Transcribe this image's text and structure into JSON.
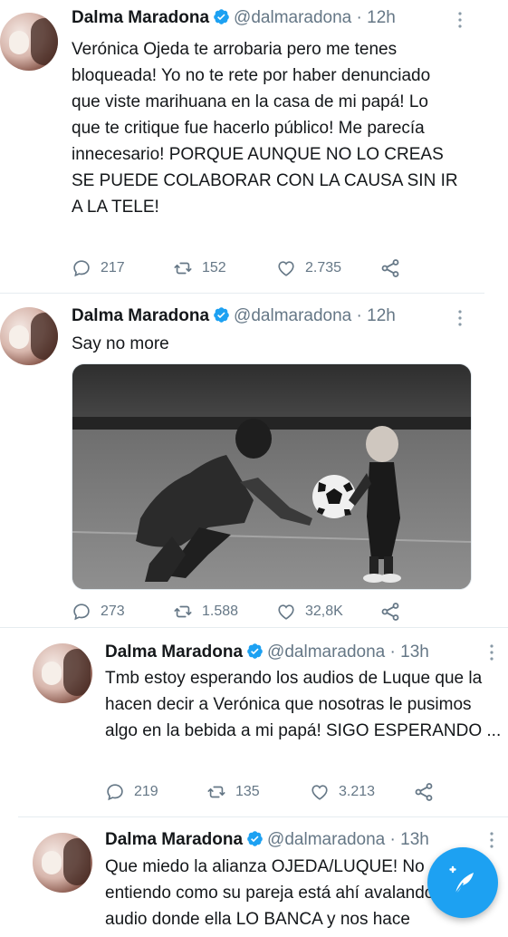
{
  "colors": {
    "accent": "#1da1f2",
    "text": "#14171a",
    "secondary": "#657786",
    "divider": "#e6ecf0"
  },
  "tweets": [
    {
      "author_name": "Dalma Maradona",
      "handle": "@dalmaradona",
      "separator": "·",
      "time": "12h",
      "verified": true,
      "text": "Verónica Ojeda te arrobaria pero me tenes bloqueada! Yo no te rete por haber denunciado que viste marihuana en la casa de mi papá! Lo que te critique fue hacerlo público! Me parecía innecesario! PORQUE AUNQUE NO LO CREAS SE PUEDE COLABORAR CON LA CAUSA SIN IR A LA TELE!",
      "replies": "217",
      "retweets": "152",
      "likes": "2.735"
    },
    {
      "author_name": "Dalma Maradona",
      "handle": "@dalmaradona",
      "separator": "·",
      "time": "12h",
      "verified": true,
      "text": "Say no more",
      "has_photo": true,
      "replies": "273",
      "retweets": "1.588",
      "likes": "32,8K"
    },
    {
      "author_name": "Dalma Maradona",
      "handle": "@dalmaradona",
      "separator": "·",
      "time": "13h",
      "verified": true,
      "text": "Tmb estoy esperando los audios de Luque que la hacen decir a Verónica que nosotras le pusimos algo en la bebida a mi papá! SIGO ESPERANDO ...",
      "replies": "219",
      "retweets": "135",
      "likes": "3.213"
    },
    {
      "author_name": "Dalma Maradona",
      "handle": "@dalmaradona",
      "separator": "·",
      "time": "13h",
      "verified": true,
      "text": "Que miedo la alianza OJEDA/LUQUE! No entiendo como su pareja está ahí avalando un audio donde ella LO BANCA y nos hace"
    }
  ],
  "icons": {
    "reply": "reply-icon",
    "retweet": "retweet-icon",
    "like": "like-icon",
    "share": "share-icon",
    "more": "more-icon",
    "verified": "verified-badge-icon",
    "compose": "compose-tweet-icon"
  }
}
